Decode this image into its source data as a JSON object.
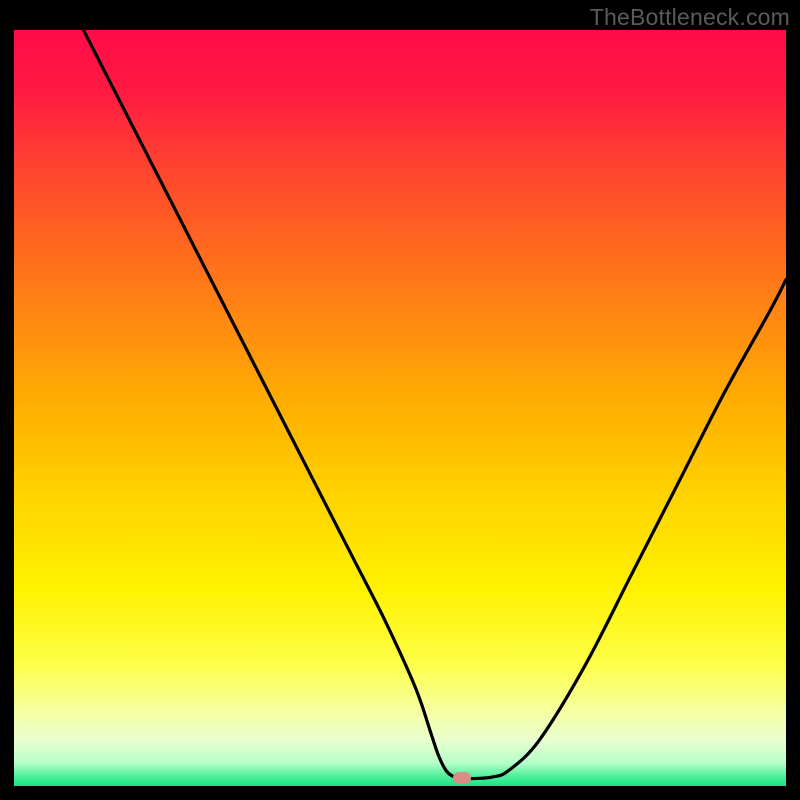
{
  "watermark": "TheBottleneck.com",
  "chart_data": {
    "type": "line",
    "title": "",
    "xlabel": "",
    "ylabel": "",
    "xlim": [
      0,
      100
    ],
    "ylim": [
      0,
      100
    ],
    "series": [
      {
        "name": "curve",
        "x": [
          9,
          12,
          18,
          24,
          30,
          36,
          40,
          44,
          48,
          52,
          54,
          55,
          56,
          57,
          58,
          60,
          62,
          64,
          68,
          74,
          80,
          86,
          92,
          98,
          100
        ],
        "y": [
          100,
          94,
          82,
          70,
          58,
          46,
          38,
          30,
          22,
          13,
          7,
          4,
          2,
          1.2,
          1,
          1,
          1.2,
          2,
          6,
          16,
          28,
          40,
          52,
          63,
          67
        ]
      }
    ],
    "marker": {
      "x": 58,
      "y": 1,
      "color": "#d98d84"
    },
    "gradient_stops": [
      {
        "offset": 0.0,
        "color": "#ff0b48"
      },
      {
        "offset": 0.08,
        "color": "#ff1a42"
      },
      {
        "offset": 0.2,
        "color": "#ff4a2c"
      },
      {
        "offset": 0.35,
        "color": "#ff7e16"
      },
      {
        "offset": 0.5,
        "color": "#ffb000"
      },
      {
        "offset": 0.62,
        "color": "#ffd400"
      },
      {
        "offset": 0.74,
        "color": "#fff200"
      },
      {
        "offset": 0.84,
        "color": "#fdff4a"
      },
      {
        "offset": 0.9,
        "color": "#f6ffa0"
      },
      {
        "offset": 0.94,
        "color": "#e8ffd0"
      },
      {
        "offset": 0.97,
        "color": "#b3ffc8"
      },
      {
        "offset": 0.985,
        "color": "#5cf0a0"
      },
      {
        "offset": 1.0,
        "color": "#13e683"
      }
    ]
  }
}
